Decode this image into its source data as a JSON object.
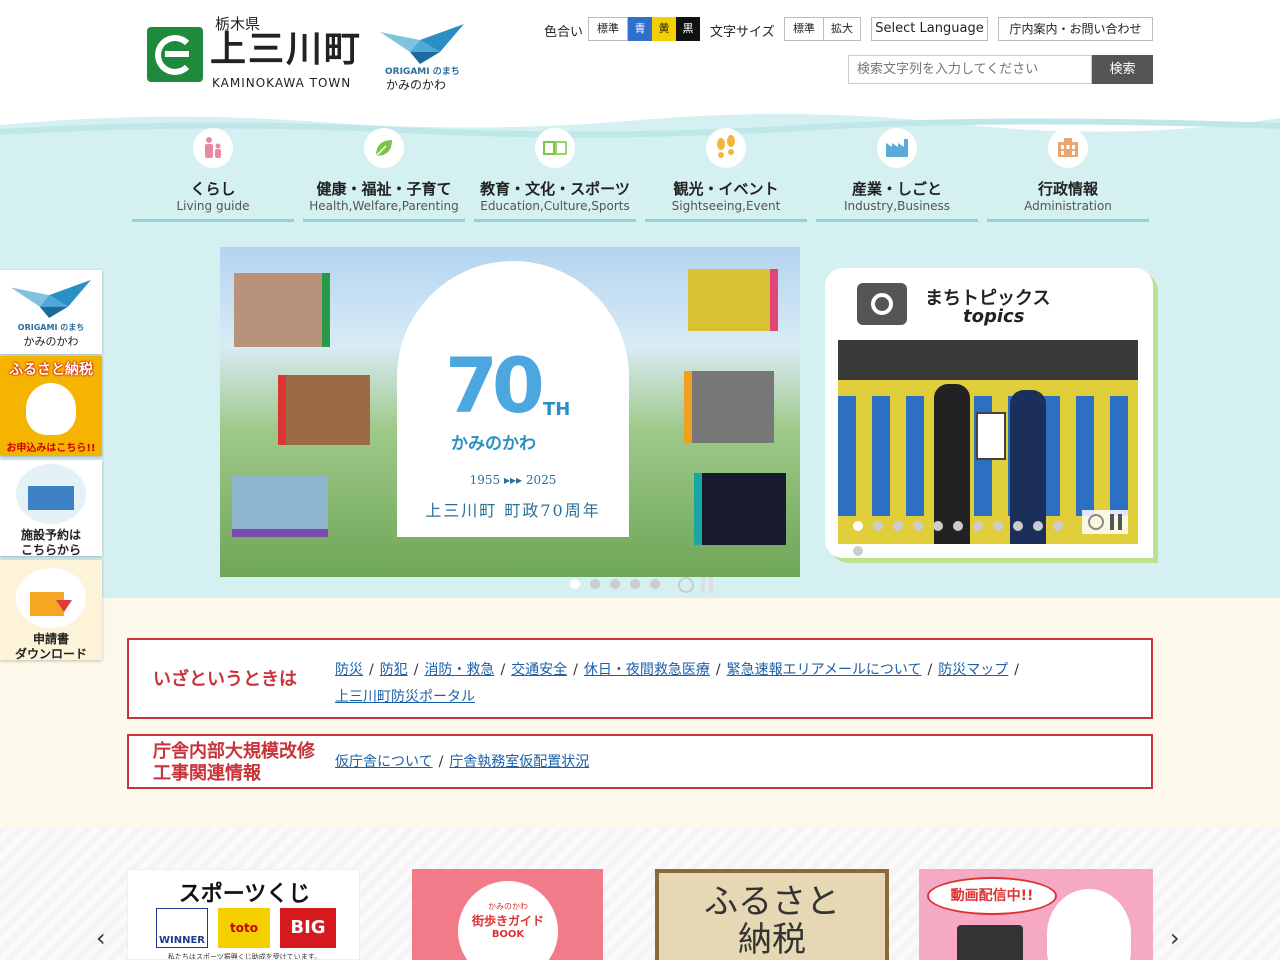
{
  "header": {
    "prefecture": "栃木県",
    "town_name": "上三川町",
    "town_name_en": "KAMINOKAWA TOWN",
    "origami_en": "ORIGAMI のまち",
    "origami_ja": "かみのかわ",
    "color_label": "色合い",
    "color_options": [
      "標準",
      "青",
      "黄",
      "黒"
    ],
    "font_label": "文字サイズ",
    "font_options": [
      "標準",
      "拡大"
    ],
    "language": "Select Language",
    "contact": "庁内案内・お問い合わせ",
    "search_placeholder": "検索文字列を入力してください",
    "search_button": "検索"
  },
  "nav": [
    {
      "ja": "くらし",
      "en": "Living guide",
      "icon": "person-icon"
    },
    {
      "ja": "健康・福祉・子育て",
      "en": "Health,Welfare,Parenting",
      "icon": "leaf-icon"
    },
    {
      "ja": "教育・文化・スポーツ",
      "en": "Education,Culture,Sports",
      "icon": "book-icon"
    },
    {
      "ja": "観光・イベント",
      "en": "Sightseeing,Event",
      "icon": "footprints-icon"
    },
    {
      "ja": "産業・しごと",
      "en": "Industry,Business",
      "icon": "factory-icon"
    },
    {
      "ja": "行政情報",
      "en": "Administration",
      "icon": "building-icon"
    }
  ],
  "side": {
    "origami_en": "ORIGAMI のまち",
    "origami_ja": "かみのかわ",
    "furusato_title": "ふるさと納税",
    "furusato_apply": "お申込みはこちら!!",
    "facility_line1": "施設予約は",
    "facility_line2": "こちらから",
    "form_line1": "申請書",
    "form_line2": "ダウンロード"
  },
  "slider": {
    "anniv_num": "70",
    "anniv_th": "TH",
    "anniv_kana": "かみのかわ",
    "years": "1955 ▸▸▸ 2025",
    "caption": "上三川町 町政70周年"
  },
  "topics": {
    "title": "まちトピックス",
    "subtitle": "topics"
  },
  "emergency": {
    "title": "いざというときは",
    "links": [
      "防災",
      "防犯",
      "消防・救急",
      "交通安全",
      "休日・夜間救急医療",
      "緊急速報エリアメールについて",
      "防災マップ",
      "上三川町防災ポータル"
    ]
  },
  "renovation": {
    "title_line1": "庁舎内部大規模改修",
    "title_line2": "工事関連情報",
    "links": [
      "仮庁舎について",
      "庁舎執務室仮配置状況"
    ]
  },
  "banners": {
    "sports_title": "スポーツくじ",
    "sports_winner": "WINNER",
    "sports_toto": "toto",
    "sports_big": "BIG",
    "sports_note": "私たちはスポーツ振興くじ助成を受けています。",
    "guide_line1": "かみのかわ",
    "guide_line2": "街歩きガイド",
    "guide_line3": "BOOK",
    "furusato_line1": "ふるさと",
    "furusato_line2": "納税",
    "video": "動画配信中!!"
  },
  "colors": {
    "brand_green": "#1f8a3c",
    "emergency_red": "#c9343b",
    "link_blue": "#1a5fa8",
    "nav_underline": "#8fd4d9"
  }
}
